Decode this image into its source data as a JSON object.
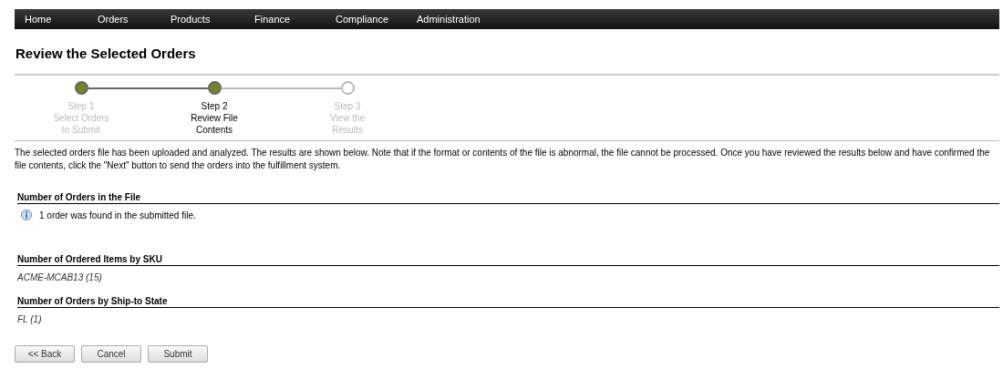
{
  "nav": {
    "items": [
      {
        "label": "Home"
      },
      {
        "label": "Orders"
      },
      {
        "label": "Products"
      },
      {
        "label": "Finance"
      },
      {
        "label": "Compliance"
      },
      {
        "label": "Administration"
      }
    ]
  },
  "title": "Review the Selected Orders",
  "steps": [
    {
      "completed": true,
      "selected": false,
      "lines": [
        "Step 1",
        "Select Orders",
        "to Submit"
      ]
    },
    {
      "completed": true,
      "selected": true,
      "lines": [
        "Step 2",
        "Review File",
        "Contents"
      ]
    },
    {
      "completed": false,
      "selected": false,
      "lines": [
        "Step 3",
        "View the",
        "Results"
      ]
    }
  ],
  "intro": "The selected orders file has been uploaded and analyzed. The results are shown below. Note that if the format or contents of the file is abnormal, the file cannot be processed. Once you have reviewed the results below and have confirmed the file contents, click the \"Next\" button to send the orders into the fulfillment system.",
  "sections": [
    {
      "heading": "Number of Orders in the File",
      "kind": "info",
      "text": "1 order was found in the submitted file."
    },
    {
      "heading": "Number of Ordered Items by SKU",
      "kind": "list",
      "text": "ACME-MCAB13 (15)"
    },
    {
      "heading": "Number of Orders by Ship-to State",
      "kind": "list",
      "text": "FL (1)"
    }
  ],
  "buttons": [
    {
      "label": "<< Back"
    },
    {
      "label": "Cancel"
    },
    {
      "label": "Submit"
    }
  ]
}
